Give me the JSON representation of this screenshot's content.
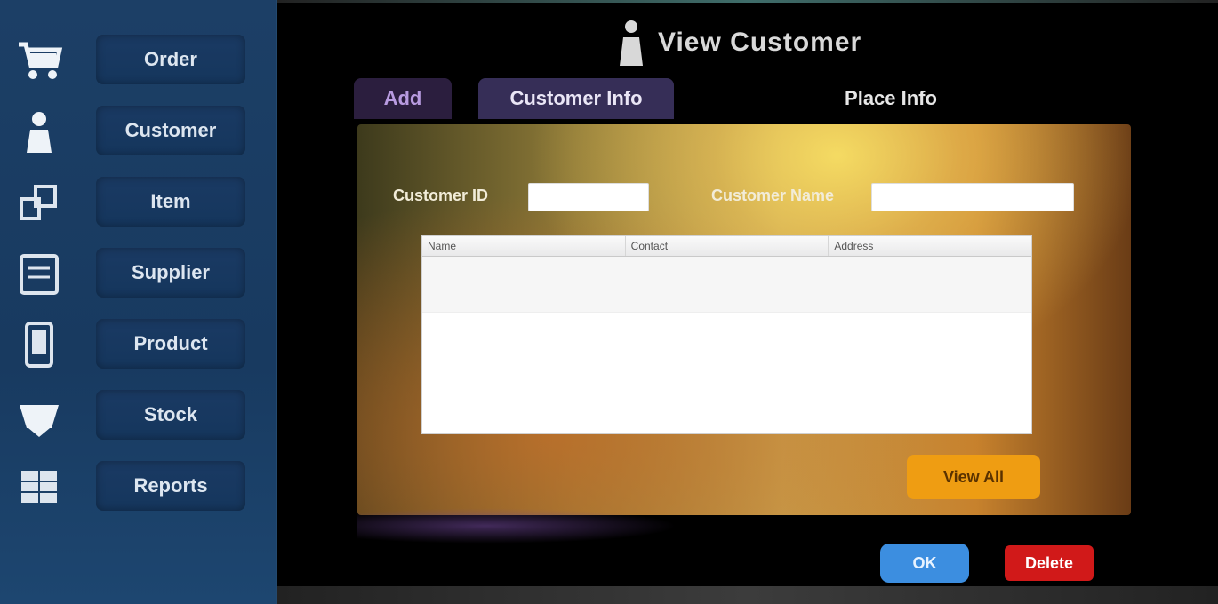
{
  "sidebar": {
    "items": [
      {
        "label": "Order",
        "icon": "cart-icon"
      },
      {
        "label": "Customer",
        "icon": "person-icon"
      },
      {
        "label": "Item",
        "icon": "boxes-icon"
      },
      {
        "label": "Supplier",
        "icon": "clipboard-icon"
      },
      {
        "label": "Product",
        "icon": "tablet-icon"
      },
      {
        "label": "Stock",
        "icon": "basket-icon"
      },
      {
        "label": "Reports",
        "icon": "grid-icon"
      }
    ]
  },
  "header": {
    "title": "View Customer",
    "icon": "person-icon"
  },
  "tabs": [
    {
      "label": "Add"
    },
    {
      "label": "Customer Info"
    },
    {
      "label": "Place Info"
    }
  ],
  "form": {
    "customer_id_label": "Customer ID",
    "customer_id_value": "",
    "customer_name_label": "Customer Name",
    "customer_name_value": ""
  },
  "table": {
    "columns": [
      "Name",
      "Contact",
      "Address"
    ],
    "rows": []
  },
  "buttons": {
    "view_all": "View All",
    "ok": "OK",
    "delete": "Delete"
  },
  "colors": {
    "sidebar_bg": "#1c3f66",
    "accent_orange": "#ef9d12",
    "ok_blue": "#3c8ee0",
    "delete_red": "#d11919"
  }
}
